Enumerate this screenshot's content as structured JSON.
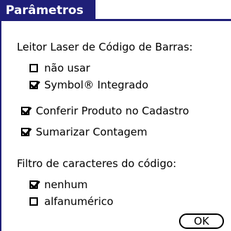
{
  "title": "Parâmetros",
  "laser_section": {
    "label": "Leitor Laser de Código de Barras:",
    "options": [
      {
        "label": "não usar",
        "checked": false
      },
      {
        "label": "Symbol® Integrado",
        "checked": true
      }
    ]
  },
  "toggles": [
    {
      "label": "Conferir Produto no Cadastro",
      "checked": true
    },
    {
      "label": "Sumarizar Contagem",
      "checked": true
    }
  ],
  "filter_section": {
    "label": "Filtro de caracteres do código:",
    "options": [
      {
        "label": "nenhum",
        "checked": true
      },
      {
        "label": "alfanumérico",
        "checked": false
      }
    ]
  },
  "ok_label": "OK",
  "colors": {
    "accent": "#1f1f78",
    "background": "#ffffff"
  }
}
